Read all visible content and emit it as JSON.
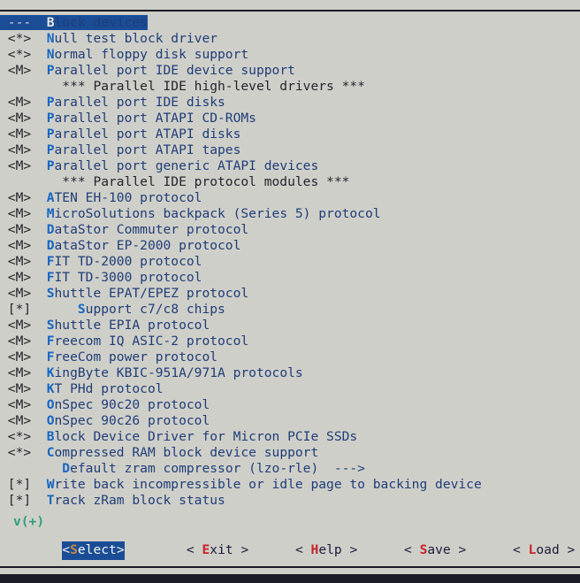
{
  "window": {
    "title": "Block devices",
    "background_color": "#cfcfc9",
    "rule_color": "#1b1b24",
    "bottom_band_color": "#1c1c26"
  },
  "colors": {
    "label": "#1f3d78",
    "hotkey": "#1466c4",
    "comment": "#24242c",
    "marker": "#24242c",
    "highlight_bg": "#1a4d96",
    "highlight_fg": "#f2f2ef",
    "button_hotkey": "#c9202a",
    "active_button_hotkey": "#c08a3e",
    "scroll_indicator": "#2f9e7d"
  },
  "menu": {
    "selected_index": 0,
    "rows": [
      {
        "marker": "---",
        "indent": 0,
        "hot": "B",
        "rest": "lock devices",
        "type": "menu",
        "selected": true
      },
      {
        "marker": "<*>",
        "indent": 0,
        "hot": "N",
        "rest": "ull test block driver",
        "type": "option"
      },
      {
        "marker": "<*>",
        "indent": 0,
        "hot": "N",
        "rest": "ormal floppy disk support",
        "type": "option"
      },
      {
        "marker": "<M>",
        "indent": 0,
        "hot": "P",
        "rest": "arallel port IDE device support",
        "type": "option"
      },
      {
        "marker": "",
        "indent": 1,
        "hot": "",
        "rest": "*** Parallel IDE high-level drivers ***",
        "type": "comment"
      },
      {
        "marker": "<M>",
        "indent": 0,
        "hot": "P",
        "rest": "arallel port IDE disks",
        "type": "option"
      },
      {
        "marker": "<M>",
        "indent": 0,
        "hot": "P",
        "rest": "arallel port ATAPI CD-ROMs",
        "type": "option"
      },
      {
        "marker": "<M>",
        "indent": 0,
        "hot": "P",
        "rest": "arallel port ATAPI disks",
        "type": "option"
      },
      {
        "marker": "<M>",
        "indent": 0,
        "hot": "P",
        "rest": "arallel port ATAPI tapes",
        "type": "option"
      },
      {
        "marker": "<M>",
        "indent": 0,
        "hot": "P",
        "rest": "arallel port generic ATAPI devices",
        "type": "option"
      },
      {
        "marker": "",
        "indent": 1,
        "hot": "",
        "rest": "*** Parallel IDE protocol modules ***",
        "type": "comment"
      },
      {
        "marker": "<M>",
        "indent": 0,
        "hot": "A",
        "rest": "TEN EH-100 protocol",
        "type": "option"
      },
      {
        "marker": "<M>",
        "indent": 0,
        "hot": "M",
        "rest": "icroSolutions backpack (Series 5) protocol",
        "type": "option"
      },
      {
        "marker": "<M>",
        "indent": 0,
        "hot": "D",
        "rest": "ataStor Commuter protocol",
        "type": "option"
      },
      {
        "marker": "<M>",
        "indent": 0,
        "hot": "D",
        "rest": "ataStor EP-2000 protocol",
        "type": "option"
      },
      {
        "marker": "<M>",
        "indent": 0,
        "hot": "F",
        "rest": "IT TD-2000 protocol",
        "type": "option"
      },
      {
        "marker": "<M>",
        "indent": 0,
        "hot": "F",
        "rest": "IT TD-3000 protocol",
        "type": "option"
      },
      {
        "marker": "<M>",
        "indent": 0,
        "hot": "S",
        "rest": "huttle EPAT/EPEZ protocol",
        "type": "option"
      },
      {
        "marker": "[*]",
        "indent": 2,
        "hot": "S",
        "rest": "upport c7/c8 chips",
        "type": "option"
      },
      {
        "marker": "<M>",
        "indent": 0,
        "hot": "S",
        "rest": "huttle EPIA protocol",
        "type": "option"
      },
      {
        "marker": "<M>",
        "indent": 0,
        "hot": "F",
        "rest": "reecom IQ ASIC-2 protocol",
        "type": "option"
      },
      {
        "marker": "<M>",
        "indent": 0,
        "hot": "F",
        "rest": "reeCom power protocol",
        "type": "option"
      },
      {
        "marker": "<M>",
        "indent": 0,
        "hot": "K",
        "rest": "ingByte KBIC-951A/971A protocols",
        "type": "option"
      },
      {
        "marker": "<M>",
        "indent": 0,
        "hot": "K",
        "rest": "T PHd protocol",
        "type": "option"
      },
      {
        "marker": "<M>",
        "indent": 0,
        "hot": "O",
        "rest": "nSpec 90c20 protocol",
        "type": "option"
      },
      {
        "marker": "<M>",
        "indent": 0,
        "hot": "O",
        "rest": "nSpec 90c26 protocol",
        "type": "option"
      },
      {
        "marker": "<*>",
        "indent": 0,
        "hot": "B",
        "rest": "lock Device Driver for Micron PCIe SSDs",
        "type": "option"
      },
      {
        "marker": "<*>",
        "indent": 0,
        "hot": "C",
        "rest": "ompressed RAM block device support",
        "type": "option"
      },
      {
        "marker": "",
        "indent": 1,
        "hot": "D",
        "rest": "efault zram compressor (lzo-rle)  --->",
        "type": "choice"
      },
      {
        "marker": "[*]",
        "indent": 0,
        "hot": "W",
        "rest": "rite back incompressible or idle page to backing device",
        "type": "option"
      },
      {
        "marker": "[*]",
        "indent": 0,
        "hot": "T",
        "rest": "rack zRam block status",
        "type": "option"
      }
    ],
    "scroll_indicator": "v(+)"
  },
  "buttons": [
    {
      "left": "<",
      "hot": "S",
      "rest": "elect",
      "right": ">",
      "active": true
    },
    {
      "left": "< ",
      "hot": "E",
      "rest": "xit",
      "right": " >",
      "active": false
    },
    {
      "left": "< ",
      "hot": "H",
      "rest": "elp",
      "right": " >",
      "active": false
    },
    {
      "left": "< ",
      "hot": "S",
      "rest": "ave",
      "right": " >",
      "active": false
    },
    {
      "left": "< ",
      "hot": "L",
      "rest": "oad",
      "right": " >",
      "active": false
    }
  ]
}
